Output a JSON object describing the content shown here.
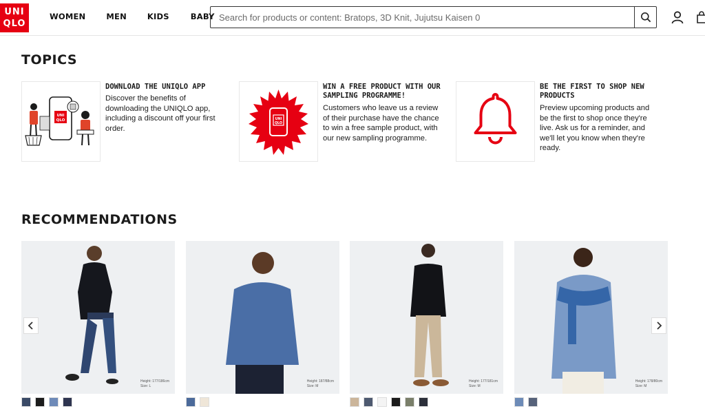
{
  "header": {
    "logo_lines": [
      "UNI",
      "QLO"
    ],
    "nav": [
      "WOMEN",
      "MEN",
      "KIDS",
      "BABY"
    ],
    "search_placeholder": "Search for products or content: Bratops, 3D Knit, Jujutsu Kaisen 0",
    "brand_color": "#e60012"
  },
  "topics": {
    "title": "TOPICS",
    "items": [
      {
        "title": "DOWNLOAD THE UNIQLO APP",
        "description": "Discover the benefits of downloading the UNIQLO app, including a discount off your first order.",
        "icon": "app-illustration"
      },
      {
        "title": "WIN A FREE PRODUCT WITH OUR SAMPLING PROGRAMME!",
        "description": "Customers who leave us a review of their purchase have the chance to win a free sample product, with our new sampling programme.",
        "icon": "starburst-phone-icon"
      },
      {
        "title": "BE THE FIRST TO SHOP NEW PRODUCTS",
        "description": "Preview upcoming products and be the first to shop once they're live. Ask us for a reminder, and we'll let you know when they're ready.",
        "icon": "bell-icon"
      }
    ]
  },
  "recommendations": {
    "title": "RECOMMENDATIONS",
    "items": [
      {
        "meta1": "Height: 177/186cm",
        "meta2": "Size: L",
        "swatches": [
          "#3a4a66",
          "#1c1c1c",
          "#6e8ab8",
          "#2e3550"
        ]
      },
      {
        "meta1": "Height: 187/88cm",
        "meta2": "Size: M",
        "swatches": [
          "#4b6a9a",
          "#efe6d8"
        ]
      },
      {
        "meta1": "Height: 177/181cm",
        "meta2": "Size: M",
        "swatches": [
          "#cbb59a",
          "#4e5a70",
          "#f4f4f4",
          "#1b1b1b",
          "#7a7f6a",
          "#2c2f3a"
        ]
      },
      {
        "meta1": "Height: 178/80cm",
        "meta2": "Size: M",
        "swatches": [
          "#6d8bb7",
          "#56627a"
        ]
      }
    ]
  }
}
